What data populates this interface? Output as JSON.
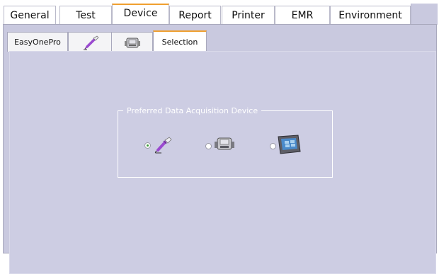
{
  "outer_tabs": [
    {
      "label": "General",
      "active": false
    },
    {
      "label": "Test",
      "active": false
    },
    {
      "label": "Device",
      "active": true
    },
    {
      "label": "Report",
      "active": false
    },
    {
      "label": "Printer",
      "active": false
    },
    {
      "label": "EMR",
      "active": false
    },
    {
      "label": "Environment",
      "active": false
    }
  ],
  "inner_tabs": [
    {
      "label": "EasyOnePro",
      "active": false
    },
    {
      "icon": "spirometer-pen-icon",
      "active": false
    },
    {
      "icon": "desktop-spirometer-icon",
      "active": false
    },
    {
      "label": "Selection",
      "active": true
    }
  ],
  "device_group": {
    "title": "Preferred Data Acquisition Device",
    "options": [
      {
        "icon": "spirometer-pen-icon",
        "selected": true
      },
      {
        "icon": "desktop-spirometer-icon",
        "selected": false
      },
      {
        "icon": "tablet-device-icon",
        "selected": false
      }
    ]
  },
  "colors": {
    "tab_accent": "#f0a030",
    "panel_background": "#cdcde3",
    "selected_radio": "#3a9a3a"
  }
}
